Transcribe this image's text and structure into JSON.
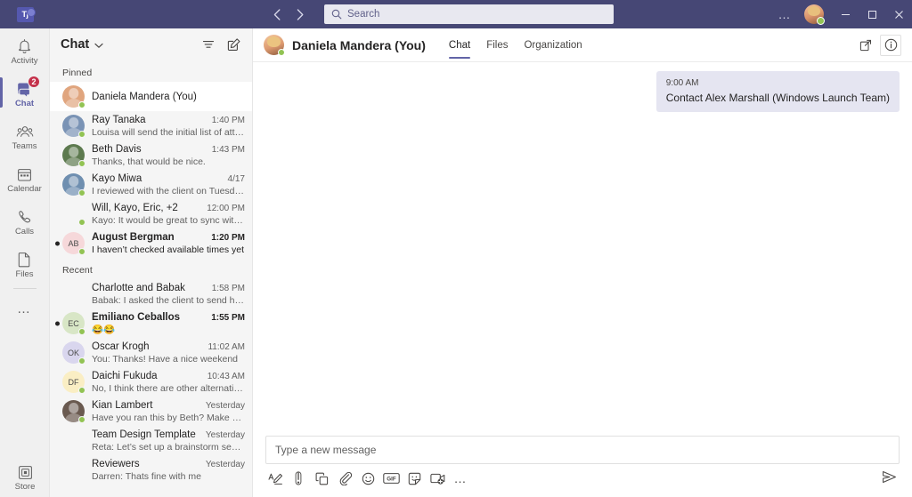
{
  "titlebar": {
    "logo_text": "Tj",
    "back_icon": "chevron-left-icon",
    "forward_icon": "chevron-right-icon",
    "search": {
      "placeholder": "Search",
      "value": "",
      "icon": "search-icon"
    },
    "settings_more": "…",
    "minimize": "—",
    "maximize": "□",
    "close": "✕",
    "accent_color": "#464775"
  },
  "rail": {
    "items": [
      {
        "label": "Activity",
        "icon": "bell-icon",
        "active": false,
        "badge": ""
      },
      {
        "label": "Chat",
        "icon": "chat-icon",
        "active": true,
        "badge": "2"
      },
      {
        "label": "Teams",
        "icon": "teams-icon",
        "active": false,
        "badge": ""
      },
      {
        "label": "Calendar",
        "icon": "calendar-icon",
        "active": false,
        "badge": ""
      },
      {
        "label": "Calls",
        "icon": "phone-icon",
        "active": false,
        "badge": ""
      },
      {
        "label": "Files",
        "icon": "file-icon",
        "active": false,
        "badge": ""
      }
    ],
    "more_label": "…",
    "store": {
      "label": "Store",
      "icon": "store-icon"
    }
  },
  "chatlist": {
    "title": "Chat",
    "chevron_icon": "chevron-down-icon",
    "filter_icon": "filter-icon",
    "compose_icon": "new-chat-icon",
    "sections": [
      {
        "label": "Pinned",
        "items": [
          {
            "name": "Daniela Mandera (You)",
            "time": "",
            "preview": "",
            "unread": false,
            "selected": true,
            "avatar": {
              "type": "photo",
              "color": "#e0a57e"
            }
          },
          {
            "name": "Ray Tanaka",
            "time": "1:40 PM",
            "preview": "Louisa will send the initial list of atte…",
            "unread": false,
            "selected": false,
            "avatar": {
              "type": "photo",
              "color": "#7a93b5"
            }
          },
          {
            "name": "Beth Davis",
            "time": "1:43 PM",
            "preview": "Thanks, that would be nice.",
            "unread": false,
            "selected": false,
            "avatar": {
              "type": "photo",
              "color": "#5d7a4f"
            }
          },
          {
            "name": "Kayo Miwa",
            "time": "4/17",
            "preview": "I reviewed with the client on Tuesda…",
            "unread": false,
            "selected": false,
            "avatar": {
              "type": "photo",
              "color": "#6f8fb0"
            }
          },
          {
            "name": "Will, Kayo, Eric, +2",
            "time": "12:00 PM",
            "preview": "Kayo: It would be great to sync with…",
            "unread": false,
            "selected": false,
            "avatar": {
              "type": "group3",
              "color": "#9a8e7d"
            }
          },
          {
            "name": "August Bergman",
            "time": "1:20 PM",
            "preview": "I haven’t checked available times yet",
            "unread": true,
            "selected": false,
            "avatar": {
              "type": "initials",
              "initials": "AB",
              "color": "#f6d8da"
            }
          }
        ]
      },
      {
        "label": "Recent",
        "items": [
          {
            "name": "Charlotte and Babak",
            "time": "1:58 PM",
            "preview": "Babak: I asked the client to send her feed…",
            "unread": false,
            "selected": false,
            "avatar": {
              "type": "group2",
              "color": "#c98f8a"
            }
          },
          {
            "name": "Emiliano Ceballos",
            "time": "1:55 PM",
            "preview": "😂😂",
            "unread": true,
            "selected": false,
            "avatar": {
              "type": "initials",
              "initials": "EC",
              "color": "#d8e6c6"
            }
          },
          {
            "name": "Oscar Krogh",
            "time": "11:02 AM",
            "preview": "You: Thanks! Have a nice weekend",
            "unread": false,
            "selected": false,
            "avatar": {
              "type": "initials",
              "initials": "OK",
              "color": "#d9d6ee"
            }
          },
          {
            "name": "Daichi Fukuda",
            "time": "10:43 AM",
            "preview": "No, I think there are other alternatives we c…",
            "unread": false,
            "selected": false,
            "avatar": {
              "type": "initials",
              "initials": "DF",
              "color": "#faeec4"
            }
          },
          {
            "name": "Kian Lambert",
            "time": "Yesterday",
            "preview": "Have you ran this by Beth? Make sure she is…",
            "unread": false,
            "selected": false,
            "avatar": {
              "type": "photo",
              "color": "#5a4b44"
            }
          },
          {
            "name": "Team Design Template",
            "time": "Yesterday",
            "preview": "Reta: Let’s set up a brainstorm session for…",
            "unread": false,
            "selected": false,
            "avatar": {
              "type": "group3",
              "color": "#b98f7a"
            }
          },
          {
            "name": "Reviewers",
            "time": "Yesterday",
            "preview": "Darren: Thats fine with me",
            "unread": false,
            "selected": false,
            "avatar": {
              "type": "group3",
              "color": "#8c8c9c"
            }
          }
        ]
      }
    ]
  },
  "conversation": {
    "title": "Daniela Mandera (You)",
    "avatar_icon": "contact-avatar",
    "tabs": [
      {
        "label": "Chat",
        "active": true
      },
      {
        "label": "Files",
        "active": false
      },
      {
        "label": "Organization",
        "active": false
      }
    ],
    "popout_icon": "pop-out-icon",
    "info_icon": "info-icon",
    "messages": [
      {
        "time": "9:00 AM",
        "text": "Contact Alex Marshall (Windows Launch Team)",
        "outgoing": true
      }
    ]
  },
  "composer": {
    "placeholder": "Type a new message",
    "value": "",
    "tools": [
      {
        "icon": "format-icon",
        "label": "Format"
      },
      {
        "icon": "priority-icon",
        "label": "Set delivery options"
      },
      {
        "icon": "loop-icon",
        "label": "Loop components"
      },
      {
        "icon": "attach-icon",
        "label": "Attach"
      },
      {
        "icon": "emoji-icon",
        "label": "Emoji"
      },
      {
        "icon": "gif-icon",
        "label": "GIF"
      },
      {
        "icon": "sticker-icon",
        "label": "Sticker"
      },
      {
        "icon": "meet-now-icon",
        "label": "Meet now"
      },
      {
        "icon": "more-options-icon",
        "label": "…"
      }
    ],
    "send_icon": "send-icon"
  }
}
